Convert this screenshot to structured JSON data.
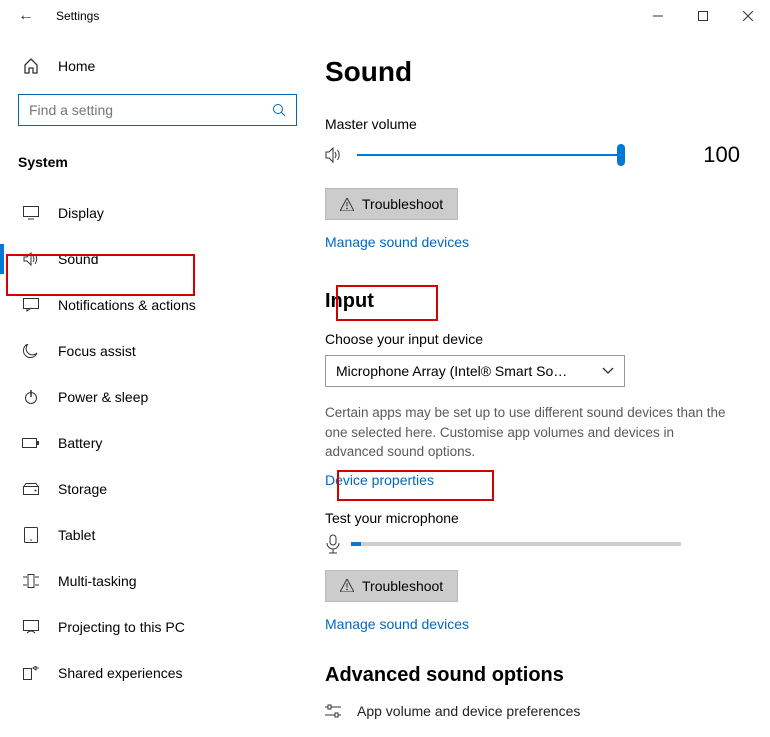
{
  "titlebar": {
    "title": "Settings"
  },
  "sidebar": {
    "home_label": "Home",
    "search_placeholder": "Find a setting",
    "section_title": "System",
    "items": [
      {
        "label": "Display"
      },
      {
        "label": "Sound"
      },
      {
        "label": "Notifications & actions"
      },
      {
        "label": "Focus assist"
      },
      {
        "label": "Power & sleep"
      },
      {
        "label": "Battery"
      },
      {
        "label": "Storage"
      },
      {
        "label": "Tablet"
      },
      {
        "label": "Multi-tasking"
      },
      {
        "label": "Projecting to this PC"
      },
      {
        "label": "Shared experiences"
      }
    ]
  },
  "content": {
    "page_title": "Sound",
    "output": {
      "master_volume_label": "Master volume",
      "volume_value": "100",
      "troubleshoot_label": "Troubleshoot",
      "manage_link": "Manage sound devices"
    },
    "input": {
      "section_title": "Input",
      "choose_label": "Choose your input device",
      "device_selected": "Microphone Array (Intel® Smart So…",
      "helper_text": "Certain apps may be set up to use different sound devices than the one selected here. Customise app volumes and devices in advanced sound options.",
      "device_props_link": "Device properties",
      "test_label": "Test your microphone",
      "troubleshoot_label": "Troubleshoot",
      "manage_link": "Manage sound devices"
    },
    "advanced": {
      "section_title": "Advanced sound options",
      "cutoff_text": "App volume and device preferences"
    }
  }
}
